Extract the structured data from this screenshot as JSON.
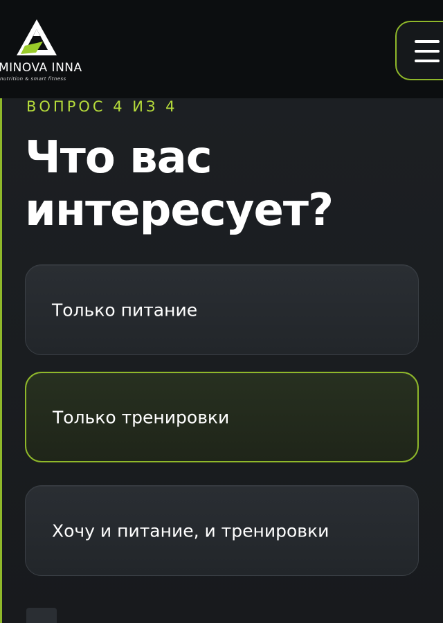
{
  "header": {
    "logo": {
      "name": "MINOVA INNA",
      "tagline": "nutrition & smart fitness",
      "mark_icon": "triangle-a-logo-icon"
    },
    "menu_icon": "hamburger-menu-icon"
  },
  "quiz": {
    "step": "ВОПРОС 4 ИЗ 4",
    "title": "Что вас интересует?",
    "options": [
      {
        "label": "Только питание",
        "selected": false
      },
      {
        "label": "Только тренировки",
        "selected": true
      },
      {
        "label": "Хочу и питание, и тренировки",
        "selected": false
      }
    ]
  },
  "colors": {
    "accent": "#8fb82a",
    "accent_text": "#b6dc3b",
    "background": "#1b1e22",
    "header_bg": "#0c0e10"
  }
}
